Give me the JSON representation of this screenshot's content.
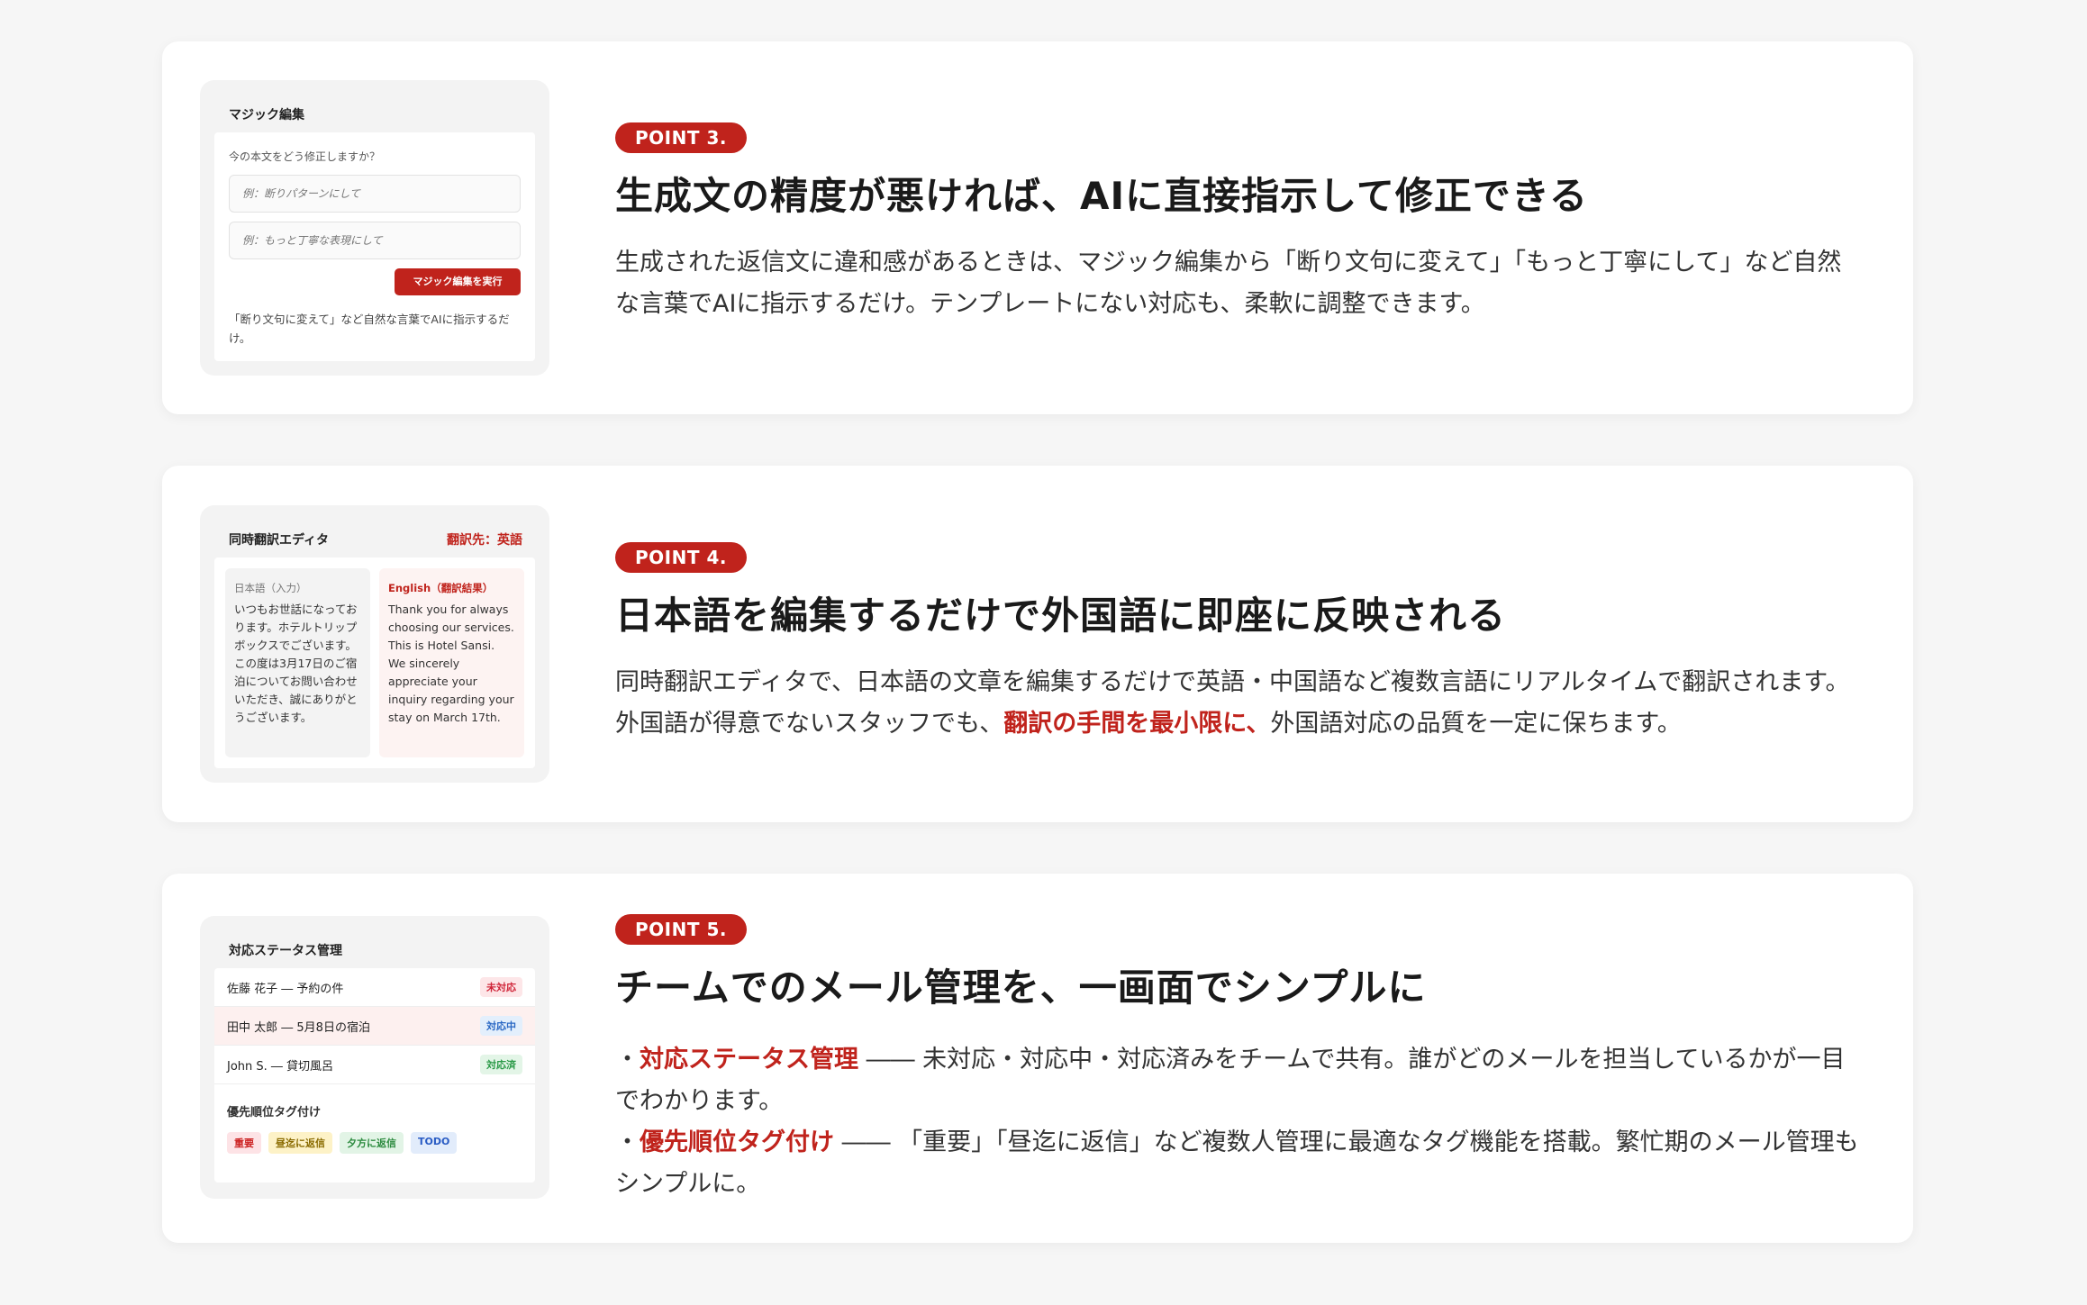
{
  "points": [
    {
      "badge": "POINT 3.",
      "title": "生成文の精度が悪ければ、AIに直接指示して修正できる",
      "desc": "生成された返信文に違和感があるときは、マジック編集から「断り文句に変えて」「もっと丁寧にして」など自然な言葉でAIに指示するだけ。テンプレートにない対応も、柔軟に調整できます。",
      "mock": {
        "title": "マジック編集",
        "question": "今の本文をどう修正しますか？",
        "placeholder1": "例：断りパターンにして",
        "placeholder2": "例：もっと丁寧な表現にして",
        "button": "マジック編集を実行",
        "note": "「断り文句に変えて」など自然な言葉でAIに指示するだけ。"
      }
    },
    {
      "badge": "POINT 4.",
      "title": "日本語を編集するだけで外国語に即座に反映される",
      "desc_before": "同時翻訳エディタで、日本語の文章を編集するだけで英語・中国語など複数言語にリアルタイムで翻訳されます。外国語が得意でないスタッフでも、",
      "desc_highlight": "翻訳の手間を最小限に、",
      "desc_after": "外国語対応の品質を一定に保ちます。",
      "mock": {
        "title": "同時翻訳エディタ",
        "target": "翻訳先：英語",
        "jp_header": "日本語（入力）",
        "jp_text": "いつもお世話になっております。ホテルトリップボックスでございます。この度は3月17日のご宿泊についてお問い合わせいただき、誠にありがとうございます。",
        "en_header": "English（翻訳結果）",
        "en_text": "Thank you for always choosing our services. This is Hotel Sansi. We sincerely appreciate your inquiry regarding your stay on March 17th."
      }
    },
    {
      "badge": "POINT 5.",
      "title": "チームでのメール管理を、一画面でシンプルに",
      "bullet1_prefix": "・",
      "bullet1_highlight": "対応ステータス管理",
      "bullet1_text": " ―― 未対応・対応中・対応済みをチームで共有。誰がどのメールを担当しているかが一目でわかります。",
      "bullet2_prefix": "・",
      "bullet2_highlight": "優先順位タグ付け",
      "bullet2_text": " ―― 「重要」「昼迄に返信」など複数人管理に最適なタグ機能を搭載。繁忙期のメール管理もシンプルに。",
      "mock": {
        "title": "対応ステータス管理",
        "rows": [
          {
            "name": "佐藤 花子 ― 予約の件",
            "status": "未対応"
          },
          {
            "name": "田中 太郎 ― 5月8日の宿泊",
            "status": "対応中"
          },
          {
            "name": "John S. ― 貸切風呂",
            "status": "対応済"
          }
        ],
        "tag_title": "優先順位タグ付け",
        "tags": [
          "重要",
          "昼迄に返信",
          "夕方に返信",
          "TODO"
        ]
      }
    }
  ],
  "colors": {
    "accent": "#c0231c",
    "background": "#f6f6f6",
    "card": "#ffffff"
  }
}
